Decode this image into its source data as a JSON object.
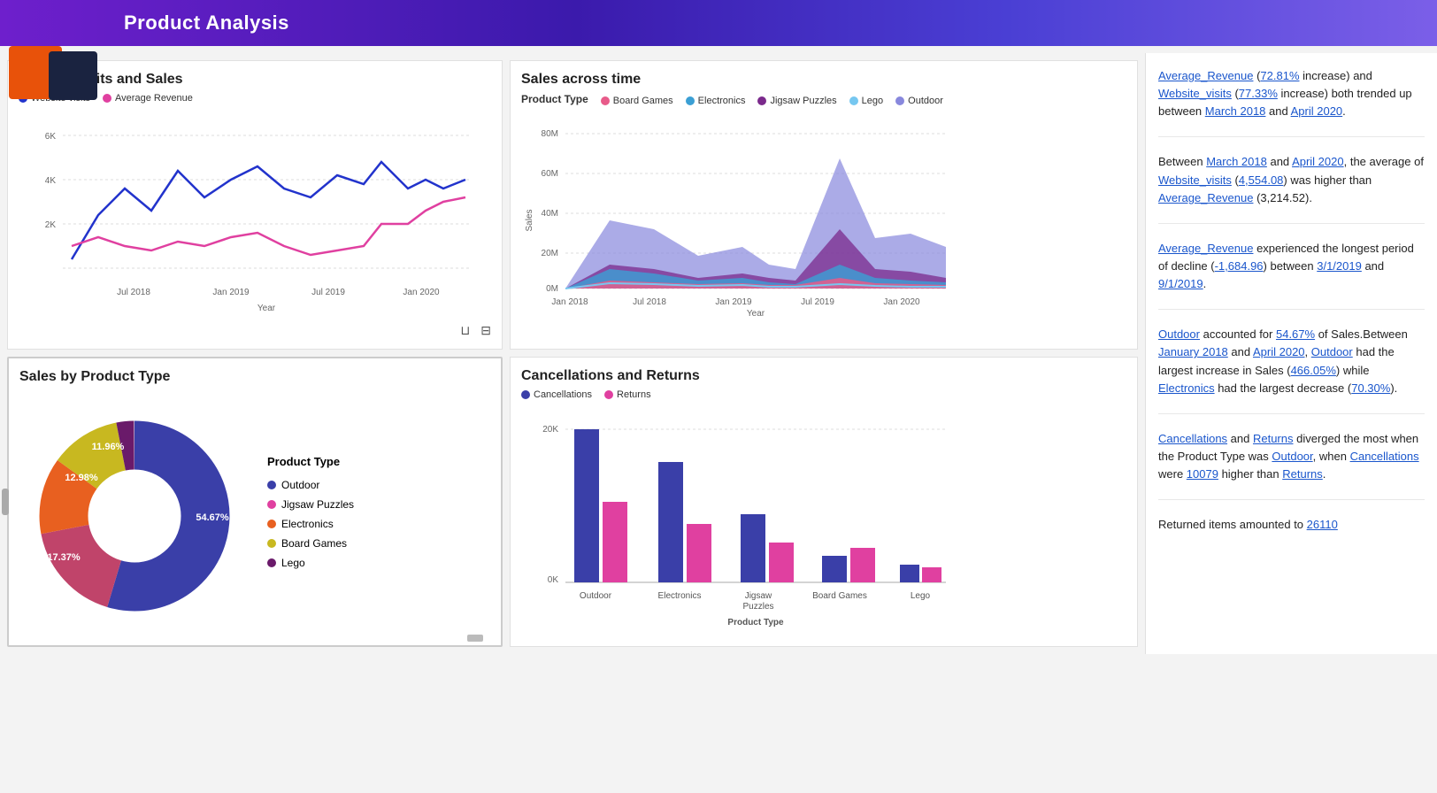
{
  "header": {
    "title": "Product Analysis"
  },
  "insights": [
    {
      "id": "insight-1",
      "html": "<span class='insight-link'>Average_Revenue</span> (<span class='insight-link'>72.81%</span> increase) and <span class='insight-link'>Website_visits</span> (<span class='insight-link'>77.33%</span> increase) both trended up between <span class='insight-link'>March 2018</span> and <span class='insight-link'>April 2020</span>."
    },
    {
      "id": "insight-2",
      "html": "Between <span class='insight-link'>March 2018</span> and <span class='insight-link'>April 2020</span>, the average of <span class='insight-link'>Website_visits</span> (<span class='insight-link'>4,554.08</span>) was higher than <span class='insight-link'>Average_Revenue</span> (3,214.52)."
    },
    {
      "id": "insight-3",
      "html": "<span class='insight-link'>Average_Revenue</span> experienced the longest period of decline (<span class='insight-link'>-1,684.96</span>) between <span class='insight-link'>3/1/2019</span> and <span class='insight-link'>9/1/2019</span>."
    },
    {
      "id": "insight-4",
      "html": "<span class='insight-link'>Outdoor</span> accounted for <span class='insight-link'>54.67%</span> of Sales. Between <span class='insight-link'>January 2018</span> and <span class='insight-link'>April 2020</span>, <span class='insight-link'>Outdoor</span> had the largest increase in Sales (<span class='insight-link'>466.05%</span>) while <span class='insight-link'>Electronics</span> had the largest decrease (<span class='insight-link'>70.30%</span>)."
    },
    {
      "id": "insight-5",
      "html": "<span class='insight-link'>Cancellations</span> and <span class='insight-link'>Returns</span> diverged the most when the Product Type was <span class='insight-link'>Outdoor</span>, when <span class='insight-link'>Cancellations</span> were <span class='insight-link'>10079</span> higher than <span class='insight-link'>Returns</span>."
    },
    {
      "id": "insight-6",
      "html": "Returned items amounted to <span class='insight-link'>26110</span>"
    }
  ],
  "charts": {
    "website_visits_sales": {
      "title": "Website visits and Sales",
      "legend": [
        {
          "label": "Website visits",
          "color": "#2233cc"
        },
        {
          "label": "Average Revenue",
          "color": "#e040a0"
        }
      ]
    },
    "sales_across_time": {
      "title": "Sales across time",
      "subtitle": "Product Type",
      "legend": [
        {
          "label": "Board Games",
          "color": "#e85b8a"
        },
        {
          "label": "Electronics",
          "color": "#3b9fd4"
        },
        {
          "label": "Jigsaw Puzzles",
          "color": "#7b2a8c"
        },
        {
          "label": "Lego",
          "color": "#76c7f0"
        },
        {
          "label": "Outdoor",
          "color": "#8888dd"
        }
      ]
    },
    "sales_by_product": {
      "title": "Sales by Product Type",
      "segments": [
        {
          "label": "Outdoor",
          "percent": 54.67,
          "color": "#3a3fa8"
        },
        {
          "label": "Jigsaw Puzzles",
          "percent": 17.37,
          "color": "#c0446a"
        },
        {
          "label": "Electronics",
          "percent": 12.98,
          "color": "#e86020"
        },
        {
          "label": "Board Games",
          "percent": 11.96,
          "color": "#c8b820"
        },
        {
          "label": "Lego",
          "percent": 2.99,
          "color": "#6a1a6a"
        }
      ]
    },
    "cancellations_returns": {
      "title": "Cancellations and Returns",
      "legend": [
        {
          "label": "Cancellations",
          "color": "#3a3fa8"
        },
        {
          "label": "Returns",
          "color": "#e040a0"
        }
      ],
      "bars": [
        {
          "label": "Outdoor",
          "cancellations": 20500,
          "returns": 10421
        },
        {
          "label": "Electronics",
          "cancellations": 14800,
          "returns": 7200
        },
        {
          "label": "Jigsaw Puzzles",
          "cancellations": 8200,
          "returns": 4800
        },
        {
          "label": "Board Games",
          "cancellations": 3200,
          "returns": 4100
        },
        {
          "label": "Lego",
          "cancellations": 2100,
          "returns": 1800
        }
      ]
    }
  }
}
